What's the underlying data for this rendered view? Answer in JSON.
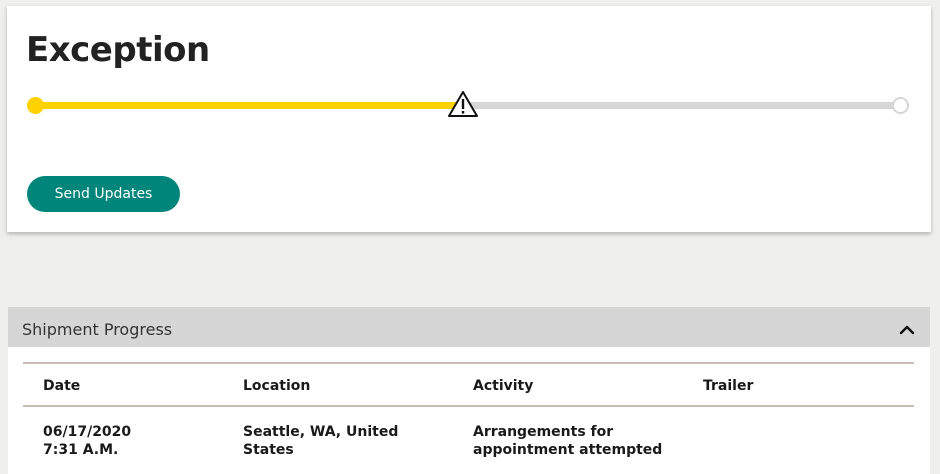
{
  "status": {
    "title": "Exception",
    "progress": 0.5,
    "accent_color": "#ffd100",
    "icon": "warning-icon"
  },
  "actions": {
    "send_updates_label": "Send Updates",
    "button_color": "#00857a"
  },
  "shipment_progress": {
    "title": "Shipment Progress",
    "collapse_icon": "chevron-up-icon",
    "columns": [
      "Date",
      "Location",
      "Activity",
      "Trailer"
    ],
    "rows": [
      {
        "date": "06/17/2020",
        "time": "7:31 A.M.",
        "location_line1": "Seattle, WA, United",
        "location_line2": "States",
        "activity_line1": "Arrangements for",
        "activity_line2": "appointment attempted",
        "trailer": ""
      }
    ]
  }
}
